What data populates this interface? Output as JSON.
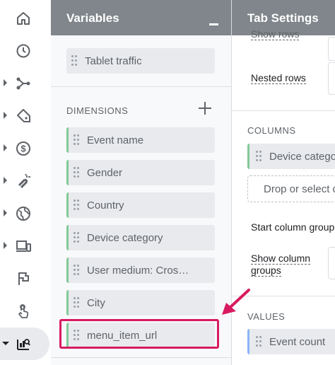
{
  "colors": {
    "panel_header": "#80868b",
    "dimension_accent": "#81c995",
    "metric_accent": "#8ab4f8",
    "highlight": "#d81b60"
  },
  "rail": {
    "items": [
      {
        "icon": "home-icon",
        "expandable": false
      },
      {
        "icon": "clock-icon",
        "expandable": false
      },
      {
        "icon": "flow-icon",
        "expandable": true
      },
      {
        "icon": "tag-icon",
        "expandable": true
      },
      {
        "icon": "dollar-icon",
        "expandable": true
      },
      {
        "icon": "magnet-icon",
        "expandable": true
      },
      {
        "icon": "globe-icon",
        "expandable": true
      },
      {
        "icon": "devices-icon",
        "expandable": true
      },
      {
        "icon": "flag-icon",
        "expandable": false
      },
      {
        "icon": "touch-icon",
        "expandable": false
      },
      {
        "icon": "explore-icon",
        "expandable": true,
        "active": true
      }
    ]
  },
  "variables": {
    "title": "Variables",
    "metrics": [
      "Tablet traffic"
    ],
    "dimensions_heading": "DIMENSIONS",
    "dimensions": [
      "Event name",
      "Gender",
      "Country",
      "Device category",
      "User medium: Cros…",
      "City",
      "menu_item_url"
    ]
  },
  "tab_settings": {
    "title": "Tab Settings",
    "show_rows": "Show rows",
    "nested_rows": "Nested rows",
    "columns_heading": "COLUMNS",
    "column_chip": "Device category",
    "drop_zone": "Drop or select d",
    "start_column_group": "Start column group",
    "show_column_groups": [
      "Show column",
      "groups"
    ],
    "values_heading": "VALUES",
    "value_chip": "Event count"
  }
}
